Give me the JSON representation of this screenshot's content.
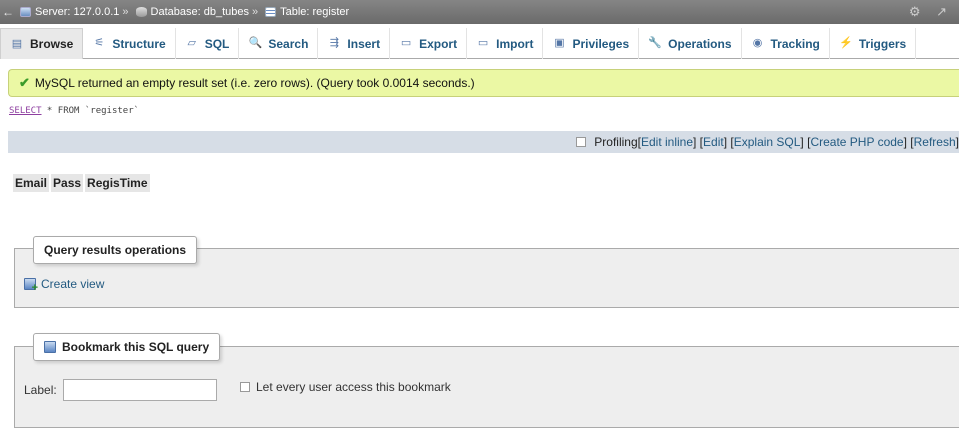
{
  "breadcrumb": {
    "back": "←",
    "server_label": "Server: 127.0.0.1",
    "database_label": "Database: db_tubes",
    "table_label": "Table: register",
    "separator": "»",
    "right_icons": "⚙ ↗"
  },
  "tabs": [
    {
      "label": "Browse",
      "icon": "browse-icon",
      "glyph": "▤",
      "active": true
    },
    {
      "label": "Structure",
      "icon": "structure-icon",
      "glyph": "⚟"
    },
    {
      "label": "SQL",
      "icon": "sql-icon",
      "glyph": "▱"
    },
    {
      "label": "Search",
      "icon": "search-icon",
      "glyph": "🔍"
    },
    {
      "label": "Insert",
      "icon": "insert-icon",
      "glyph": "⇶"
    },
    {
      "label": "Export",
      "icon": "export-icon",
      "glyph": "▭"
    },
    {
      "label": "Import",
      "icon": "import-icon",
      "glyph": "▭"
    },
    {
      "label": "Privileges",
      "icon": "privileges-icon",
      "glyph": "▣"
    },
    {
      "label": "Operations",
      "icon": "wrench-icon",
      "glyph": "🔧"
    },
    {
      "label": "Tracking",
      "icon": "eye-icon",
      "glyph": "◉"
    },
    {
      "label": "Triggers",
      "icon": "triggers-icon",
      "glyph": "⚡"
    }
  ],
  "message": {
    "text": "MySQL returned an empty result set (i.e. zero rows). (Query took 0.0014 seconds.)",
    "icon": "check-icon"
  },
  "sql": {
    "keyword": "SELECT",
    "rest": " * FROM `register`"
  },
  "profiling": {
    "label": "Profiling",
    "links": [
      "Edit inline",
      "Edit",
      "Explain SQL",
      "Create PHP code",
      "Refresh"
    ]
  },
  "columns": [
    "Email",
    "Pass",
    "RegisTime"
  ],
  "query_ops": {
    "legend": "Query results operations",
    "create_view": "Create view"
  },
  "bookmark": {
    "legend": "Bookmark this SQL query",
    "label_text": "Label:",
    "label_value": "",
    "access_text": "Let every user access this bookmark"
  },
  "colors": {
    "tab_link": "#235a81",
    "success_bg": "#ebf8a4",
    "profiling_bg": "#d6dde6",
    "breadcrumb_bg": "#777777"
  }
}
